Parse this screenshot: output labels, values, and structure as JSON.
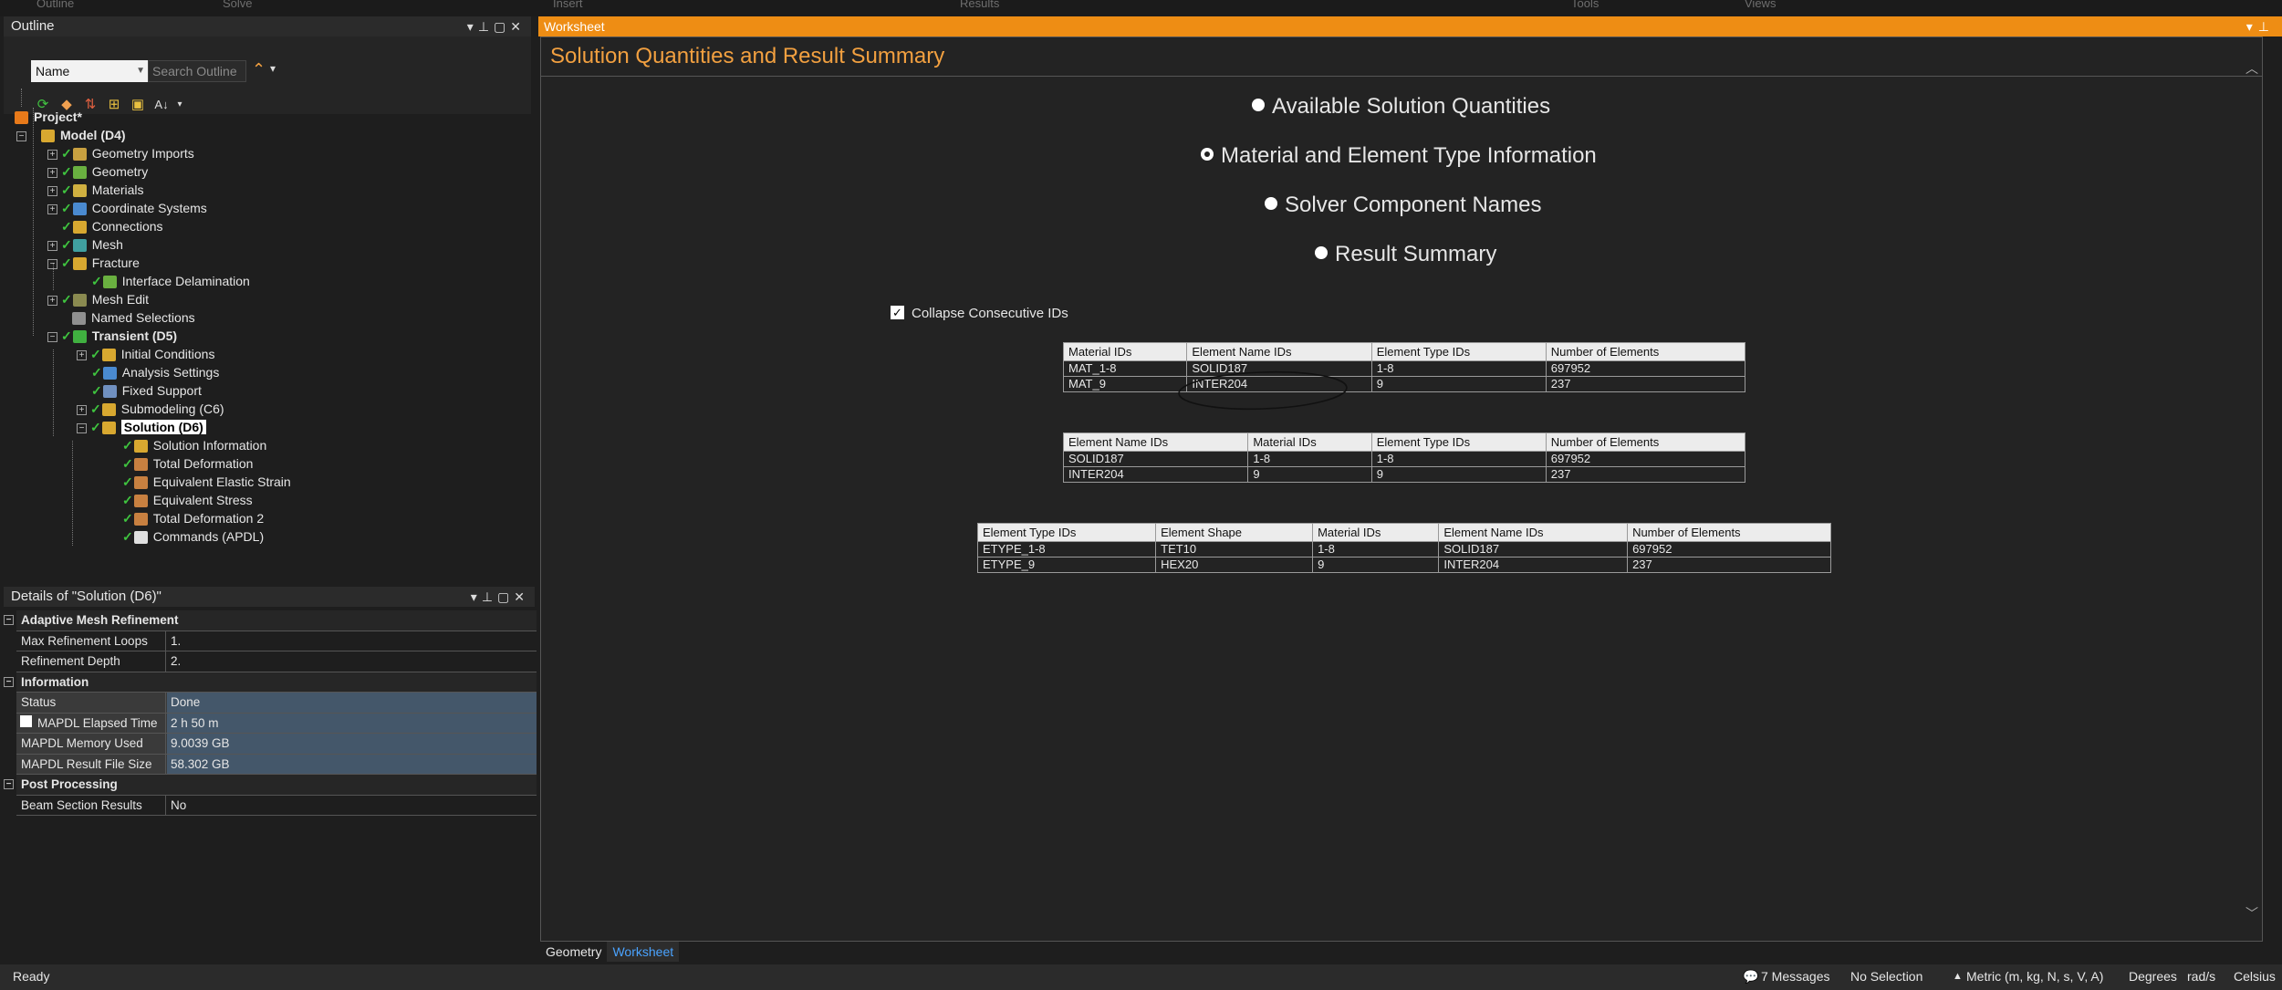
{
  "ribbon": {
    "tabs": [
      "Outline",
      "Solve",
      "Insert",
      "Results",
      "Tools",
      "Views"
    ]
  },
  "outline": {
    "title": "Outline",
    "filter_combo": "Name",
    "search_placeholder": "Search Outline",
    "tree": [
      {
        "label": "Project*",
        "level": 0,
        "bold": true,
        "icon": "project-icon"
      },
      {
        "label": "Model (D4)",
        "level": 1,
        "bold": true,
        "icon": "model-icon",
        "expanded": true
      },
      {
        "label": "Geometry Imports",
        "level": 2,
        "icon": "geometry-imports-icon"
      },
      {
        "label": "Geometry",
        "level": 2,
        "icon": "geometry-icon"
      },
      {
        "label": "Materials",
        "level": 2,
        "icon": "materials-icon"
      },
      {
        "label": "Coordinate Systems",
        "level": 2,
        "icon": "coordinate-systems-icon"
      },
      {
        "label": "Connections",
        "level": 2,
        "icon": "connections-icon"
      },
      {
        "label": "Mesh",
        "level": 2,
        "icon": "mesh-icon"
      },
      {
        "label": "Fracture",
        "level": 2,
        "icon": "fracture-icon"
      },
      {
        "label": "Interface Delamination",
        "level": 3,
        "icon": "interface-delamination-icon"
      },
      {
        "label": "Mesh Edit",
        "level": 2,
        "icon": "mesh-edit-icon"
      },
      {
        "label": "Named Selections",
        "level": 2,
        "icon": "named-selections-icon"
      },
      {
        "label": "Transient (D5)",
        "level": 2,
        "bold": true,
        "icon": "transient-icon"
      },
      {
        "label": "Initial Conditions",
        "level": 3,
        "icon": "initial-conditions-icon"
      },
      {
        "label": "Analysis Settings",
        "level": 3,
        "icon": "analysis-settings-icon"
      },
      {
        "label": "Fixed Support",
        "level": 3,
        "icon": "fixed-support-icon"
      },
      {
        "label": "Submodeling (C6)",
        "level": 3,
        "icon": "submodeling-icon"
      },
      {
        "label": "Solution (D6)",
        "level": 3,
        "bold": true,
        "selected": true,
        "icon": "solution-icon"
      },
      {
        "label": "Solution Information",
        "level": 4,
        "icon": "solution-information-icon"
      },
      {
        "label": "Total Deformation",
        "level": 4,
        "icon": "total-deformation-icon"
      },
      {
        "label": "Equivalent Elastic Strain",
        "level": 4,
        "icon": "equivalent-elastic-strain-icon"
      },
      {
        "label": "Equivalent Stress",
        "level": 4,
        "icon": "equivalent-stress-icon"
      },
      {
        "label": "Total Deformation 2",
        "level": 4,
        "icon": "total-deformation-2-icon"
      },
      {
        "label": "Commands (APDL)",
        "level": 4,
        "icon": "commands-apdl-icon"
      }
    ]
  },
  "details": {
    "title": "Details of \"Solution (D6)\"",
    "rows": [
      {
        "section": "Adaptive Mesh Refinement"
      },
      {
        "key": "Max Refinement Loops",
        "value": "1."
      },
      {
        "key": "Refinement Depth",
        "value": "2."
      },
      {
        "section": "Information"
      },
      {
        "key": "Status",
        "value": "Done",
        "hl": true
      },
      {
        "key": "MAPDL Elapsed Time",
        "value": "2 h 50 m",
        "hl": true,
        "checkbox": true
      },
      {
        "key": "MAPDL Memory Used",
        "value": "9.0039 GB",
        "hl": true
      },
      {
        "key": "MAPDL Result File Size",
        "value": "58.302 GB",
        "hl": true
      },
      {
        "section": "Post Processing"
      },
      {
        "key": "Beam Section Results",
        "value": "No"
      }
    ]
  },
  "worksheet": {
    "tab_title": "Worksheet",
    "heading": "Solution Quantities and Result Summary",
    "radios": [
      {
        "label": "Available Solution Quantities",
        "selected": false
      },
      {
        "label": "Material and Element Type Information",
        "selected": true
      },
      {
        "label": "Solver Component Names",
        "selected": false
      },
      {
        "label": "Result Summary",
        "selected": false
      }
    ],
    "collapse_label": "Collapse Consecutive IDs",
    "collapse_checked": true,
    "tables": [
      {
        "headers": [
          "Material IDs",
          "Element Name IDs",
          "Element Type IDs",
          "Number of Elements"
        ],
        "rows": [
          [
            "MAT_1-8",
            "SOLID187",
            "1-8",
            "697952"
          ],
          [
            "MAT_9",
            "INTER204",
            "9",
            "237"
          ]
        ]
      },
      {
        "headers": [
          "Element Name IDs",
          "Material IDs",
          "Element Type IDs",
          "Number of Elements"
        ],
        "rows": [
          [
            "SOLID187",
            "1-8",
            "1-8",
            "697952"
          ],
          [
            "INTER204",
            "9",
            "9",
            "237"
          ]
        ]
      },
      {
        "headers": [
          "Element Type IDs",
          "Element Shape",
          "Material IDs",
          "Element Name IDs",
          "Number of Elements"
        ],
        "rows": [
          [
            "ETYPE_1-8",
            "TET10",
            "1-8",
            "SOLID187",
            "697952"
          ],
          [
            "ETYPE_9",
            "HEX20",
            "9",
            "INTER204",
            "237"
          ]
        ]
      }
    ]
  },
  "bottom_tabs": {
    "geometry": "Geometry",
    "worksheet": "Worksheet"
  },
  "statusbar": {
    "ready": "Ready",
    "messages": "7 Messages",
    "selection": "No Selection",
    "units": "Metric (m, kg, N, s, V, A)",
    "angle": "Degrees",
    "rate": "rad/s",
    "temperature": "Celsius"
  }
}
